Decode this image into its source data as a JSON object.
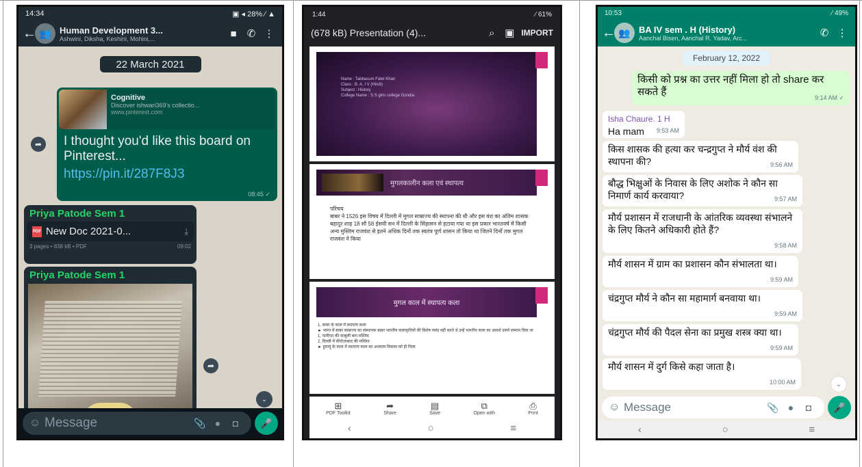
{
  "phone1": {
    "status_time": "14:34",
    "status_right": "▣ ◂ 28% ⁄ ▲",
    "group_title": "Human Development 3...",
    "group_subtitle": "Ashwini, Diksha, Keshini, Mohini,...",
    "date_chip": "22 March 2021",
    "link_title": "Cognitive",
    "link_desc": "Discover ishwari369's collectio...",
    "link_url": "www.pinterest.com",
    "message_text": "I thought you'd like this board on Pinterest...",
    "message_link": "https://pin.it/287F8J3",
    "message_time": "08:45 ✓",
    "sender1": "Priya Patode Sem 1",
    "doc_name": "New Doc 2021-0...",
    "doc_meta": "3 pages • 838 kB • PDF",
    "doc_time": "09:02",
    "sender2": "Priya Patode Sem 1",
    "input_placeholder": "Message"
  },
  "phone2": {
    "status_time": "1:44",
    "status_right": "⁄ 61%",
    "title": "(678 kB) Presentation (4)...",
    "import_label": "IMPORT",
    "slide1_lines": [
      "Name : Tabbasum Fatel Khan",
      "Class : B. A. I V (Hindi)",
      "Subject : History",
      "College Name : S.S girls college Gondia"
    ],
    "slide2_title": "मुगलकालीन कला एवं स्थापत्य",
    "slide2_body": "परिचय\nबाबर ने 1526 इस विषय में दिल्ली में मुगल साम्राज्य की स्थापना की थी और इस वंश का अंतिम शासक बहादुर शाह 18 सौ 58 ईसवी सन में दिल्ली के सिंहासन से हटाया गया था इस प्रकार भारतवर्ष में किसी अन्य मुस्लिम राजवंश से इतने अधिक दिनों तक स्वतंत्र पूर्ण शासन तो किया था जितने दिनों तक मुगल राजवंश ने किया",
    "slide3_title": "मुगल काल में स्थापत्य कला",
    "slide3_body": "1. बाबर के काल में स्थापत्य कला\n► भारत में बाबर साम्राज्य का संस्थापक बाबर भारतीय कलाकृतियों की विशेष पसंद नहीं करते थे उन्हें भारतीय कला का आदर्श उसमें सम्मान दिया था\n1. पानीपत की काबुली बाग मस्जिद\n2. दिल्ली में फ़ीरोज़ाबाद की मस्जिद\n► हुमायूं के काल में स्थापत्य कला का अध्यात्म विकास को ही मिला",
    "toolbar": [
      "PDF Toolkit",
      "Share",
      "Save",
      "Open with",
      "Print"
    ]
  },
  "phone3": {
    "status_time": "10:53",
    "status_right": "⁄ 49%",
    "group_title": "BA IV sem . H (History)",
    "group_subtitle": "Aanchal Bisen, Aanchal R. Yadav, Arc...",
    "date_chip": "February 12, 2022",
    "out_text": "किसी को प्रश्न का उत्तर नहीं मिला हो तो share कर सकते हैं",
    "out_time": "9:14 AM ✓",
    "messages": [
      {
        "sender": "Isha Chaure. 1 H",
        "text": "Ha mam",
        "time": "9:53 AM"
      },
      {
        "text": "किस शासक की हत्या कर चन्द्रगुप्त ने मौर्य वंश की स्थापना की?",
        "time": "9:56 AM"
      },
      {
        "text": "बौद्ध भिक्षुओं के निवास के लिए अशोक ने कौन सा निमार्ण कार्य करवाया?",
        "time": "9:57 AM"
      },
      {
        "text": "मौर्य प्रशासन में राजधानी के आंतरिक व्यवस्था संभालने के लिए कितने अधिकारी होते हैं?",
        "time": "9:58 AM"
      },
      {
        "text": "मौर्य शासन में ग्राम का प्रशासन कौन संभालता था।",
        "time": "9:59 AM"
      },
      {
        "text": "चंद्रगुप्त मौर्य ने कौन सा महामार्ग बनवाया था।",
        "time": "9:59 AM"
      },
      {
        "text": "चंद्रगुप्त मौर्य की पैदल सेना का प्रमुख शस्त्र क्या था।",
        "time": "9:59 AM"
      },
      {
        "text": "मौर्य शासन में दुर्ग किसे कहा जाता है।",
        "time": "10:00 AM"
      }
    ],
    "input_placeholder": "Message"
  }
}
